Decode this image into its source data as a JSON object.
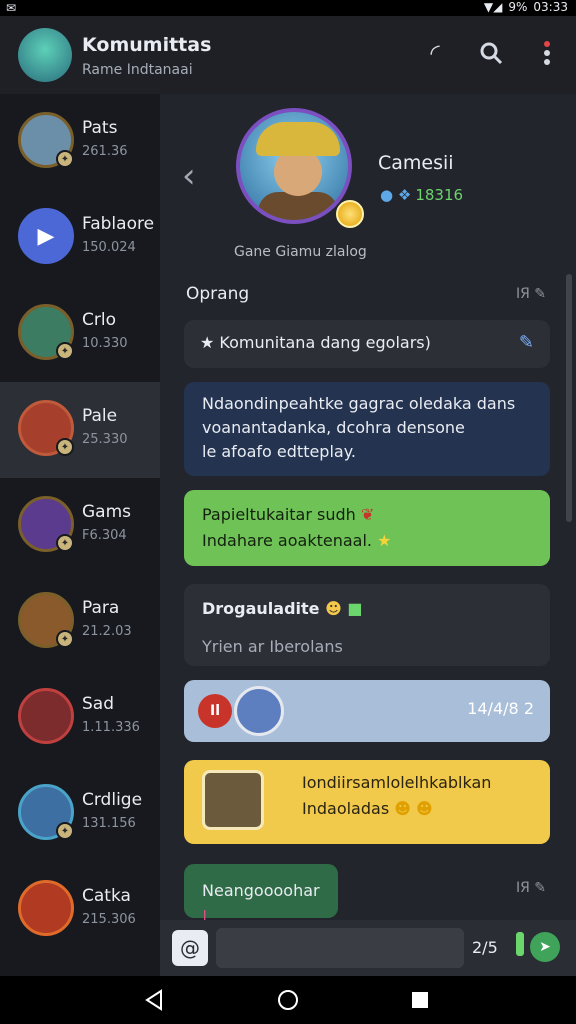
{
  "status": {
    "left": "✉",
    "signal": "▼◢",
    "battery": "9%",
    "time": "03:33"
  },
  "header": {
    "title": "Komumittas",
    "subtitle": "Rame Indtanaai",
    "icons": [
      "refresh-icon",
      "search-icon",
      "more-icon"
    ]
  },
  "sidebar": {
    "items": [
      {
        "name": "Pats",
        "num": "261.36",
        "color": "#6b8fa8"
      },
      {
        "name": "Fablaore",
        "num": "150.024",
        "color": "#4c68d6"
      },
      {
        "name": "Crlo",
        "num": "10.330",
        "color": "#3b7c62"
      },
      {
        "name": "Pale",
        "num": "25.330",
        "color": "#a6402c"
      },
      {
        "name": "Gams",
        "num": "F6.304",
        "color": "#5a3b8e"
      },
      {
        "name": "Para",
        "num": "21.2.03",
        "color": "#8a5a2c"
      },
      {
        "name": "Sad",
        "num": "1.11.336",
        "color": "#7c2c2c"
      },
      {
        "name": "Crdlige",
        "num": "131.156",
        "color": "#3d6fa3"
      },
      {
        "name": "Catka",
        "num": "215.306",
        "color": "#b03a22"
      }
    ]
  },
  "profile": {
    "name": "Camesii",
    "stats": "18316",
    "caption": "Gane Giamu zlalog"
  },
  "section": {
    "title": "Oprang",
    "tag": "IЯ"
  },
  "messages": {
    "m1": "★ Komunitana dang egolars)",
    "m2_line1": "Ndaondinpeahtke gagrac oledaka dans",
    "m2_line2": "voanantadanka, dcohra densone",
    "m2_line3": "le afoafo edtteplay.",
    "m3_line1": "Papieltukaitar sudh",
    "m3_line2": "Indahare aoaktenaal.",
    "m4_title": "Drogauladite",
    "m4_sub": "Yrien ar Iberolans",
    "m5_badge": "Il",
    "m5_time": "14/4/8 2",
    "m6_line1": "Iondiirsamlolelhkablkan",
    "m6_line2": "Indaoladas",
    "m7": "Neangoooohar"
  },
  "section2": {
    "tag": "IЯ"
  },
  "input": {
    "placeholder": "",
    "count": "2/5"
  }
}
